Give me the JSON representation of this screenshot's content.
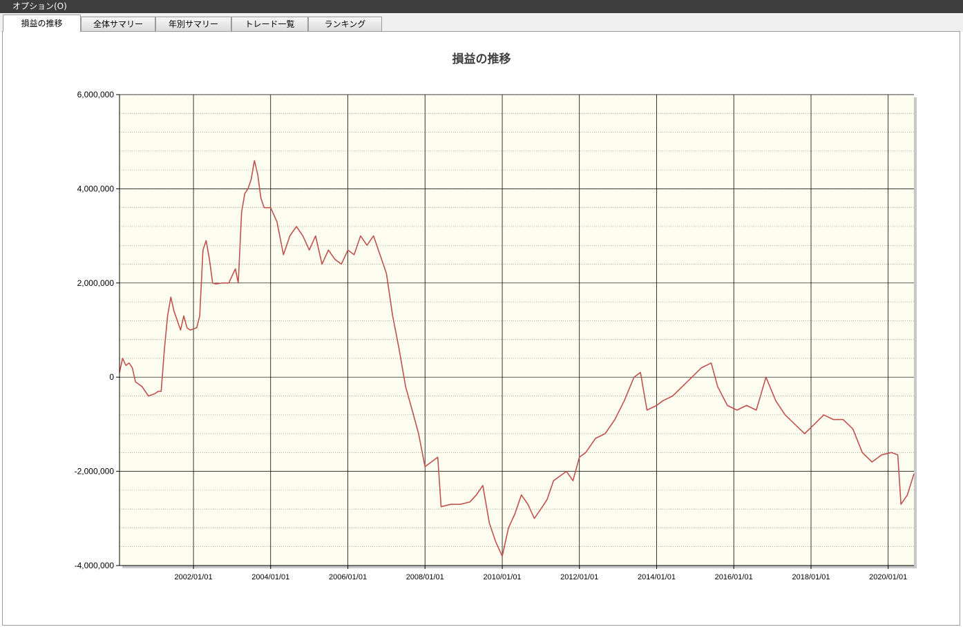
{
  "menu": {
    "options_label": "オプション(O)"
  },
  "tabs": [
    {
      "label": "損益の推移",
      "active": true
    },
    {
      "label": "全体サマリー",
      "active": false
    },
    {
      "label": "年別サマリー",
      "active": false
    },
    {
      "label": "トレード一覧",
      "active": false
    },
    {
      "label": "ランキング",
      "active": false
    }
  ],
  "colors": {
    "line": "#c0504d",
    "plot_background": "#fefef0",
    "grid": "#000000"
  },
  "chart_data": {
    "type": "line",
    "title": "損益の推移",
    "xlabel": "",
    "ylabel": "",
    "ylim": [
      -4000000,
      6000000
    ],
    "xlim": [
      "2000-02-01",
      "2020-09-01"
    ],
    "y_ticks": [
      "6,000,000",
      "4,000,000",
      "2,000,000",
      "0",
      "-2,000,000",
      "-4,000,000"
    ],
    "y_tick_values": [
      6000000,
      4000000,
      2000000,
      0,
      -2000000,
      -4000000
    ],
    "x_ticks": [
      "2002/01/01",
      "2004/01/01",
      "2006/01/01",
      "2008/01/01",
      "2010/01/01",
      "2012/01/01",
      "2014/01/01",
      "2016/01/01",
      "2018/01/01",
      "2020/01/01"
    ],
    "x_tick_dates": [
      "2002-01-01",
      "2004-01-01",
      "2006-01-01",
      "2008-01-01",
      "2010-01-01",
      "2012-01-01",
      "2014-01-01",
      "2016-01-01",
      "2018-01-01",
      "2020-01-01"
    ],
    "grid": true,
    "legend": "none",
    "series": [
      {
        "x": [
          "2000-02-01",
          "2000-03-01",
          "2000-04-01",
          "2000-05-01",
          "2000-06-01",
          "2000-07-01",
          "2000-09-01",
          "2000-11-01",
          "2001-01-01",
          "2001-02-01",
          "2001-03-01",
          "2001-04-01",
          "2001-05-01",
          "2001-06-01",
          "2001-07-01",
          "2001-08-01",
          "2001-09-01",
          "2001-10-01",
          "2001-11-01",
          "2001-12-01",
          "2002-02-01",
          "2002-03-01",
          "2002-04-01",
          "2002-05-01",
          "2002-06-01",
          "2002-07-01",
          "2002-08-01",
          "2002-09-01",
          "2002-10-01",
          "2002-12-01",
          "2003-02-01",
          "2003-03-01",
          "2003-04-01",
          "2003-05-01",
          "2003-06-01",
          "2003-07-01",
          "2003-08-01",
          "2003-09-01",
          "2003-10-01",
          "2003-11-01",
          "2004-01-01",
          "2004-03-01",
          "2004-05-01",
          "2004-07-01",
          "2004-09-01",
          "2004-11-01",
          "2005-01-01",
          "2005-03-01",
          "2005-05-01",
          "2005-07-01",
          "2005-09-01",
          "2005-11-01",
          "2006-01-01",
          "2006-03-01",
          "2006-05-01",
          "2006-07-01",
          "2006-09-01",
          "2006-11-01",
          "2007-01-01",
          "2007-03-01",
          "2007-05-01",
          "2007-07-01",
          "2007-09-01",
          "2007-11-01",
          "2008-01-01",
          "2008-03-01",
          "2008-05-01",
          "2008-06-01",
          "2008-09-01",
          "2008-12-01",
          "2009-03-01",
          "2009-05-01",
          "2009-07-01",
          "2009-09-01",
          "2009-11-01",
          "2010-01-01",
          "2010-03-01",
          "2010-05-01",
          "2010-07-01",
          "2010-09-01",
          "2010-11-01",
          "2011-01-01",
          "2011-03-01",
          "2011-05-01",
          "2011-07-01",
          "2011-09-01",
          "2011-11-01",
          "2012-01-01",
          "2012-03-01",
          "2012-06-01",
          "2012-09-01",
          "2012-12-01",
          "2013-03-01",
          "2013-06-01",
          "2013-08-01",
          "2013-10-01",
          "2014-01-01",
          "2014-03-01",
          "2014-06-01",
          "2014-09-01",
          "2014-12-01",
          "2015-03-01",
          "2015-06-01",
          "2015-08-01",
          "2015-11-01",
          "2016-02-01",
          "2016-05-01",
          "2016-08-01",
          "2016-11-01",
          "2017-02-01",
          "2017-05-01",
          "2017-08-01",
          "2017-11-01",
          "2018-02-01",
          "2018-05-01",
          "2018-08-01",
          "2018-11-01",
          "2019-02-01",
          "2019-05-01",
          "2019-08-01",
          "2019-11-01",
          "2020-02-01",
          "2020-04-01",
          "2020-05-01",
          "2020-07-01",
          "2020-09-01"
        ],
        "y": [
          100000,
          400000,
          250000,
          300000,
          200000,
          -100000,
          -200000,
          -400000,
          -350000,
          -300000,
          -300000,
          600000,
          1300000,
          1700000,
          1400000,
          1200000,
          1000000,
          1300000,
          1050000,
          1000000,
          1050000,
          1300000,
          2700000,
          2900000,
          2500000,
          2000000,
          1980000,
          1990000,
          2000000,
          2000000,
          2300000,
          2000000,
          3500000,
          3900000,
          4000000,
          4200000,
          4600000,
          4300000,
          3800000,
          3600000,
          3600000,
          3300000,
          2600000,
          3000000,
          3200000,
          3000000,
          2700000,
          3000000,
          2400000,
          2700000,
          2500000,
          2400000,
          2700000,
          2600000,
          3000000,
          2800000,
          3000000,
          2600000,
          2200000,
          1300000,
          600000,
          -200000,
          -700000,
          -1200000,
          -1900000,
          -1800000,
          -1700000,
          -2750000,
          -2700000,
          -2700000,
          -2650000,
          -2500000,
          -2300000,
          -3100000,
          -3500000,
          -3800000,
          -3200000,
          -2900000,
          -2500000,
          -2700000,
          -3000000,
          -2800000,
          -2600000,
          -2200000,
          -2100000,
          -2000000,
          -2200000,
          -1700000,
          -1600000,
          -1300000,
          -1200000,
          -900000,
          -500000,
          0,
          100000,
          -700000,
          -600000,
          -500000,
          -400000,
          -200000,
          0,
          200000,
          300000,
          -200000,
          -600000,
          -700000,
          -600000,
          -700000,
          0,
          -500000,
          -800000,
          -1000000,
          -1200000,
          -1000000,
          -800000,
          -900000,
          -900000,
          -1100000,
          -1600000,
          -1800000,
          -1650000,
          -1600000,
          -1650000,
          -2700000,
          -2500000,
          -2050000
        ]
      }
    ]
  }
}
